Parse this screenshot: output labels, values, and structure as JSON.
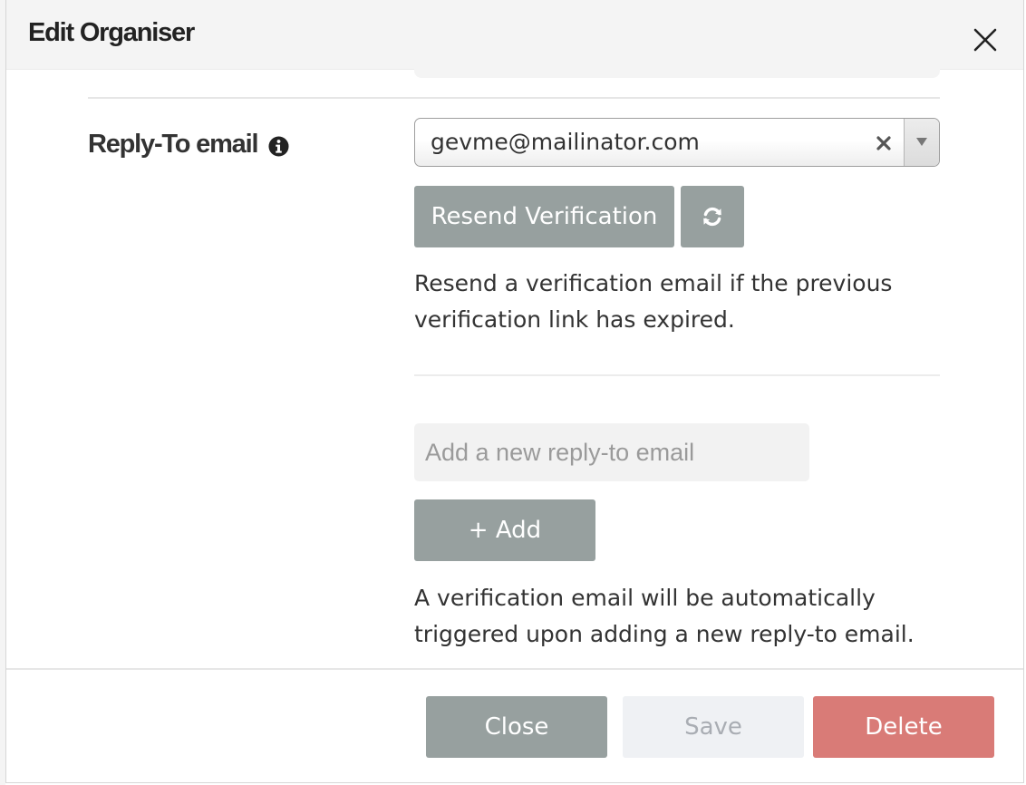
{
  "modal": {
    "title": "Edit Organiser"
  },
  "reply_to": {
    "label": "Reply-To email",
    "selected_email": "gevme@mailinator.com",
    "resend_label": "Resend Verification",
    "resend_help": "Resend a verification email if the previous verification link has expired.",
    "new_email_placeholder": "Add a new reply-to email",
    "new_email_value": "",
    "add_label": "+ Add",
    "add_help": "A verification email will be automatically triggered upon adding a new reply-to email."
  },
  "footer": {
    "close_label": "Close",
    "save_label": "Save",
    "delete_label": "Delete"
  },
  "icons": {
    "close": "close-icon",
    "info": "info-icon",
    "clear": "clear-icon",
    "dropdown": "chevron-down-icon",
    "refresh": "refresh-icon"
  },
  "colors": {
    "grey_button": "#97a09f",
    "delete_button": "#d97b77",
    "disabled_button": "#eff1f4"
  }
}
